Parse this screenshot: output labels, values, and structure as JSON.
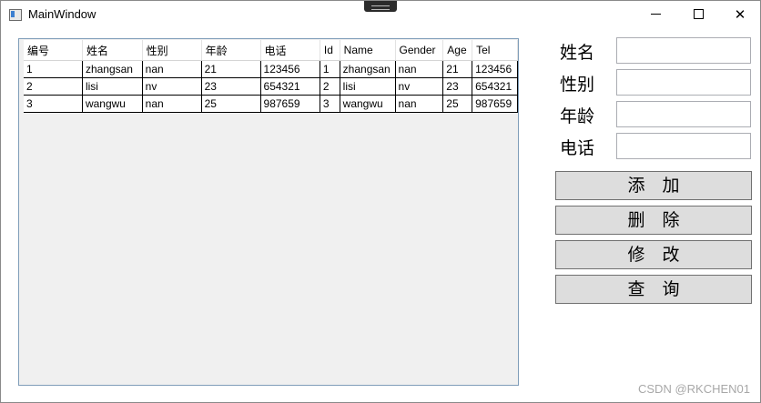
{
  "window": {
    "title": "MainWindow"
  },
  "grid": {
    "columns": [
      "编号",
      "姓名",
      "性别",
      "年龄",
      "电话",
      "Id",
      "Name",
      "Gender",
      "Age",
      "Tel"
    ],
    "rows": [
      [
        "1",
        "zhangsan",
        "nan",
        "21",
        "123456",
        "1",
        "zhangsan",
        "nan",
        "21",
        "123456"
      ],
      [
        "2",
        "lisi",
        "nv",
        "23",
        "654321",
        "2",
        "lisi",
        "nv",
        "23",
        "654321"
      ],
      [
        "3",
        "wangwu",
        "nan",
        "25",
        "987659",
        "3",
        "wangwu",
        "nan",
        "25",
        "987659"
      ]
    ]
  },
  "form": {
    "name_label": "姓名",
    "gender_label": "性别",
    "age_label": "年龄",
    "phone_label": "电话",
    "name_value": "",
    "gender_value": "",
    "age_value": "",
    "phone_value": ""
  },
  "actions": {
    "add": "添　加",
    "delete": "删　除",
    "update": "修　改",
    "query": "查　询"
  },
  "watermark": "CSDN @RKCHEN01",
  "icons": {
    "minimize": "minimize-icon",
    "maximize": "maximize-icon",
    "close": "close-icon",
    "app": "app-icon"
  }
}
